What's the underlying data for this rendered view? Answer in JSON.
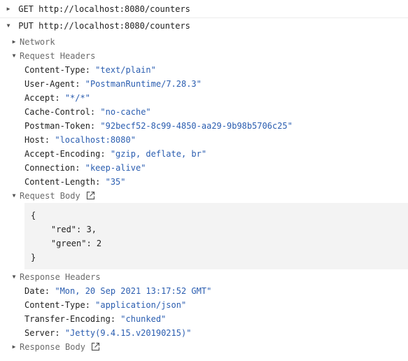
{
  "requests": [
    {
      "arrow": "▶",
      "method": "GET",
      "url": "http://localhost:8080/counters"
    },
    {
      "arrow": "▼",
      "method": "PUT",
      "url": "http://localhost:8080/counters"
    }
  ],
  "sections": {
    "network": {
      "arrow": "▶",
      "label": "Network"
    },
    "request_headers": {
      "arrow": "▼",
      "label": "Request Headers"
    },
    "request_body": {
      "arrow": "▼",
      "label": "Request Body"
    },
    "response_headers": {
      "arrow": "▼",
      "label": "Response Headers"
    },
    "response_body": {
      "arrow": "▶",
      "label": "Response Body"
    }
  },
  "request_headers": [
    {
      "key": "Content-Type:",
      "value": "\"text/plain\""
    },
    {
      "key": "User-Agent:",
      "value": "\"PostmanRuntime/7.28.3\""
    },
    {
      "key": "Accept:",
      "value": "\"*/*\""
    },
    {
      "key": "Cache-Control:",
      "value": "\"no-cache\""
    },
    {
      "key": "Postman-Token:",
      "value": "\"92becf52-8c99-4850-aa29-9b98b5706c25\""
    },
    {
      "key": "Host:",
      "value": "\"localhost:8080\""
    },
    {
      "key": "Accept-Encoding:",
      "value": "\"gzip, deflate, br\""
    },
    {
      "key": "Connection:",
      "value": "\"keep-alive\""
    },
    {
      "key": "Content-Length:",
      "value": "\"35\""
    }
  ],
  "request_body_lines": [
    "{",
    "    \"red\": 3,",
    "    \"green\": 2",
    "}"
  ],
  "response_headers": [
    {
      "key": "Date:",
      "value": "\"Mon, 20 Sep 2021 13:17:52 GMT\""
    },
    {
      "key": "Content-Type:",
      "value": "\"application/json\""
    },
    {
      "key": "Transfer-Encoding:",
      "value": "\"chunked\""
    },
    {
      "key": "Server:",
      "value": "\"Jetty(9.4.15.v20190215)\""
    }
  ],
  "icons": {
    "open_external": "open-external-icon"
  },
  "colors": {
    "value": "#2a5db0",
    "section": "#6b6b6b",
    "body_bg": "#f3f3f3"
  }
}
